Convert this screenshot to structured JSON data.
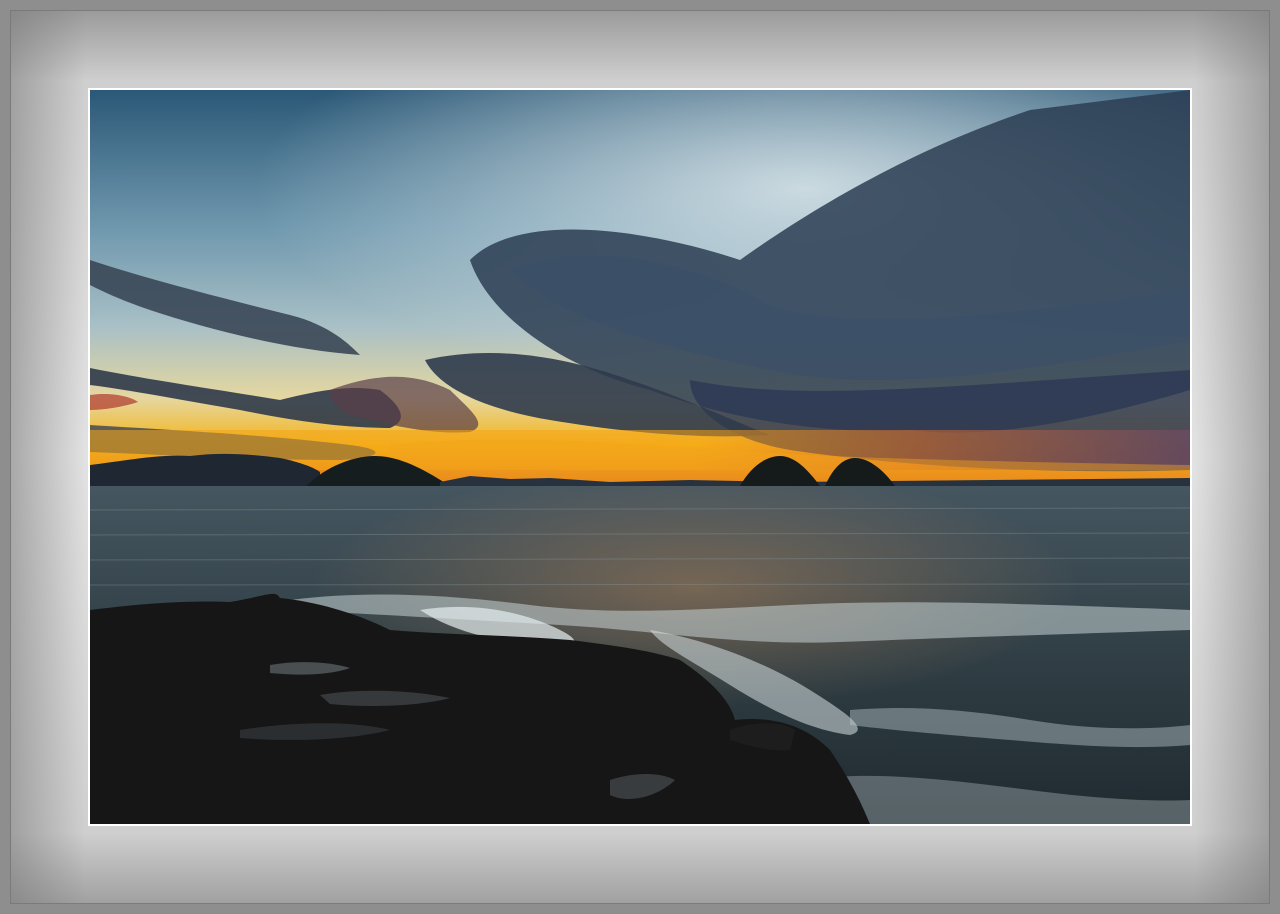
{
  "frame": {
    "outer_color": "#8e8e8e",
    "mat_color": "#e0e0e0",
    "border_color": "#ffffff"
  },
  "photo": {
    "subject": "sunset-over-sea",
    "colors": {
      "sky_top": "#2e5a76",
      "sky_mid": "#9fb8c4",
      "horizon_glow": "#f6b21a",
      "cloud_dark": "#2b3a4d",
      "sea": "#2f3c42",
      "rock": "#141414"
    }
  }
}
